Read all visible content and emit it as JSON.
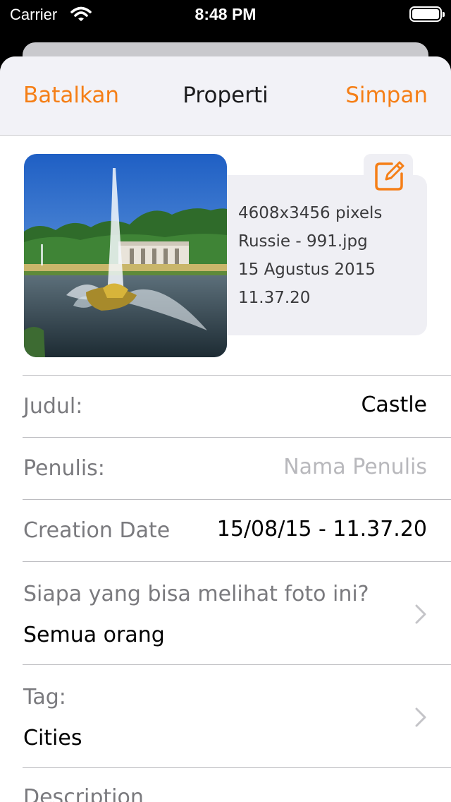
{
  "status_bar": {
    "carrier": "Carrier",
    "time": "8:48 PM"
  },
  "nav": {
    "cancel_label": "Batalkan",
    "title": "Properti",
    "save_label": "Simpan"
  },
  "photo_info": {
    "dimensions": "4608x3456 pixels",
    "filename": "Russie - 991.jpg",
    "date": "15 Agustus 2015",
    "time": "11.37.20"
  },
  "fields": {
    "title_label": "Judul:",
    "title_value": "Castle",
    "author_label": "Penulis:",
    "author_placeholder": "Nama Penulis",
    "creation_label": "Creation Date",
    "creation_value": "15/08/15 - 11.37.20",
    "visibility_label": "Siapa yang bisa melihat foto ini?",
    "visibility_value": "Semua orang",
    "tag_label": "Tag:",
    "tag_value": "Cities",
    "description_label": "Description"
  },
  "colors": {
    "accent": "#f57f17",
    "nav_background": "#f2f2f7",
    "info_background": "#efeff4"
  },
  "icons": [
    "wifi-icon",
    "battery-icon",
    "edit-icon",
    "chevron-right-icon"
  ]
}
